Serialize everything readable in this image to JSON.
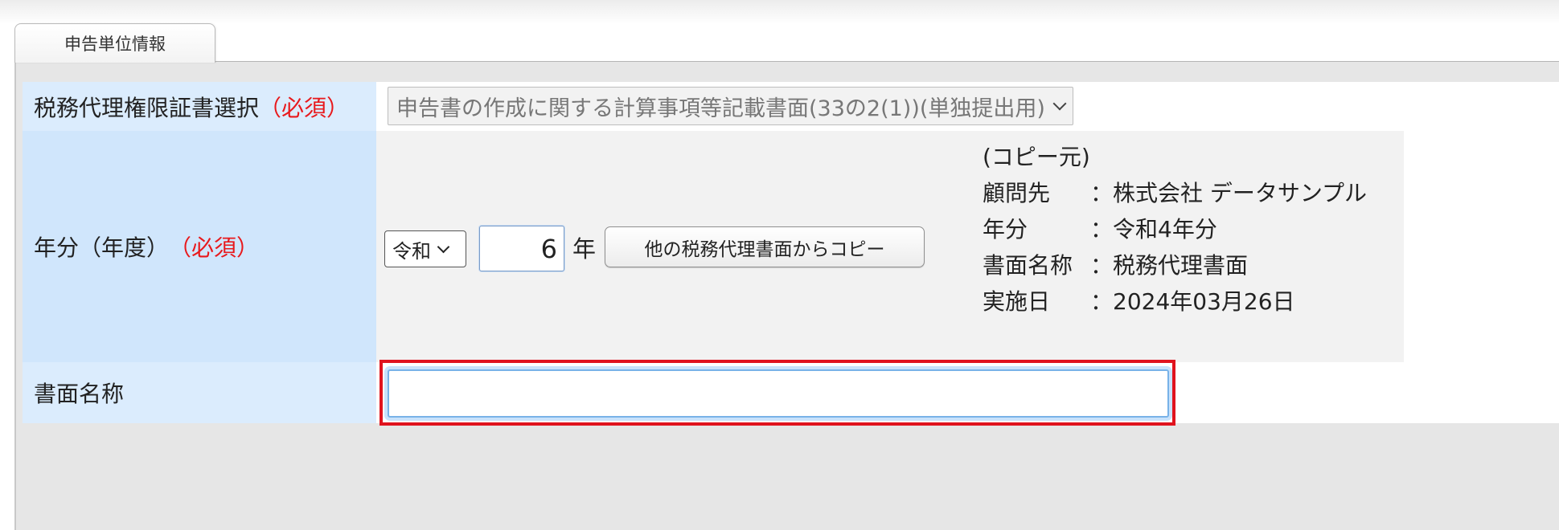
{
  "tab": {
    "label": "申告単位情報"
  },
  "form": {
    "cert": {
      "label": "税務代理権限証書選択",
      "required": "（必須）",
      "selected": "申告書の作成に関する計算事項等記載書面(33の2(1))(単独提出用)"
    },
    "year": {
      "label": "年分（年度）",
      "required": "（必須）",
      "era": "令和",
      "value": "6",
      "unit": "年",
      "copy_button": "他の税務代理書面からコピー"
    },
    "copy_source": {
      "heading": "(コピー元)",
      "client_key": "顧問先",
      "client_value": "：株式会社 データサンプル",
      "year_key": "年分",
      "year_value": "：令和4年分",
      "doc_key": "書面名称",
      "doc_value": "：税務代理書面",
      "date_key": "実施日",
      "date_value": "：2024年03月26日"
    },
    "doc_name": {
      "label": "書面名称",
      "value": ""
    }
  },
  "colors": {
    "label_bg": "#dbecfd",
    "required": "#e8191c",
    "highlight": "#e0131e"
  }
}
